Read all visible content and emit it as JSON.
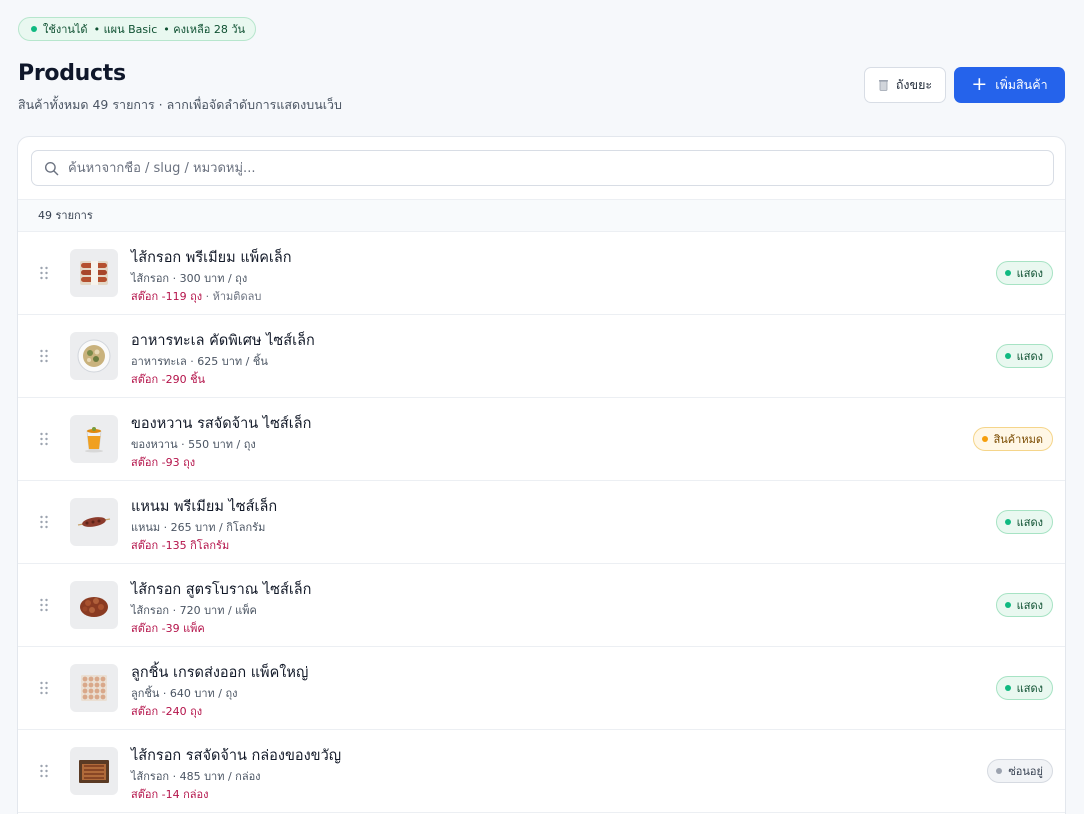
{
  "header": {
    "status": {
      "text_a": "ใช้งานได้",
      "text_b": "• แผน Basic",
      "text_c": "• คงเหลือ 28 วัน"
    },
    "title": "Products",
    "subtitle": "สินค้าทั้งหมด 49 รายการ · ลากเพื่อจัดลำดับการแสดงบนเว็บ",
    "trash_label": "ถังขยะ",
    "add_label": "เพิ่มสินค้า"
  },
  "search": {
    "placeholder": "ค้นหาจากชื่อ / slug / หมวดหมู่...",
    "value": ""
  },
  "list": {
    "count_label": "49 รายการ",
    "items": [
      {
        "name": "ไส้กรอก พรีเมียม แพ็คเล็ก",
        "meta": "ไส้กรอก · 300 บาท / ถุง",
        "stock": "สต๊อก -119 ถุง",
        "stock_note": "· ห้ามติดลบ",
        "status": "แสดง",
        "status_type": "green",
        "thumb_icon": "sausage-pack-icon"
      },
      {
        "name": "อาหารทะเล คัดพิเศษ ไซส์เล็ก",
        "meta": "อาหารทะเล · 625 บาท / ชิ้น",
        "stock": "สต๊อก -290 ชิ้น",
        "stock_note": "",
        "status": "แสดง",
        "status_type": "green",
        "thumb_icon": "seafood-plate-icon"
      },
      {
        "name": "ของหวาน รสจัดจ้าน ไซส์เล็ก",
        "meta": "ของหวาน · 550 บาท / ถุง",
        "stock": "สต๊อก -93 ถุง",
        "stock_note": "",
        "status": "สินค้าหมด",
        "status_type": "amber",
        "thumb_icon": "dessert-cup-icon"
      },
      {
        "name": "แหนม พรีเมียม ไซส์เล็ก",
        "meta": "แหนม · 265 บาท / กิโลกรัม",
        "stock": "สต๊อก -135 กิโลกรัม",
        "stock_note": "",
        "status": "แสดง",
        "status_type": "green",
        "thumb_icon": "skewer-icon"
      },
      {
        "name": "ไส้กรอก สูตรโบราณ ไซส์เล็ก",
        "meta": "ไส้กรอก · 720 บาท / แพ็ค",
        "stock": "สต๊อก -39 แพ็ค",
        "stock_note": "",
        "status": "แสดง",
        "status_type": "green",
        "thumb_icon": "sausage-pile-icon"
      },
      {
        "name": "ลูกชิ้น เกรดส่งออก แพ็คใหญ่",
        "meta": "ลูกชิ้น · 640 บาท / ถุง",
        "stock": "สต๊อก -240 ถุง",
        "stock_note": "",
        "status": "แสดง",
        "status_type": "green",
        "thumb_icon": "meatball-tray-icon"
      },
      {
        "name": "ไส้กรอก รสจัดจ้าน กล่องของขวัญ",
        "meta": "ไส้กรอก · 485 บาท / กล่อง",
        "stock": "สต๊อก -14 กล่อง",
        "stock_note": "",
        "status": "ซ่อนอยู่",
        "status_type": "gray",
        "thumb_icon": "gift-box-icon"
      }
    ]
  },
  "colors": {
    "accent": "#2563eb",
    "stock_negative": "#b4134a",
    "success": "#10b981",
    "warning": "#f59e0b"
  }
}
